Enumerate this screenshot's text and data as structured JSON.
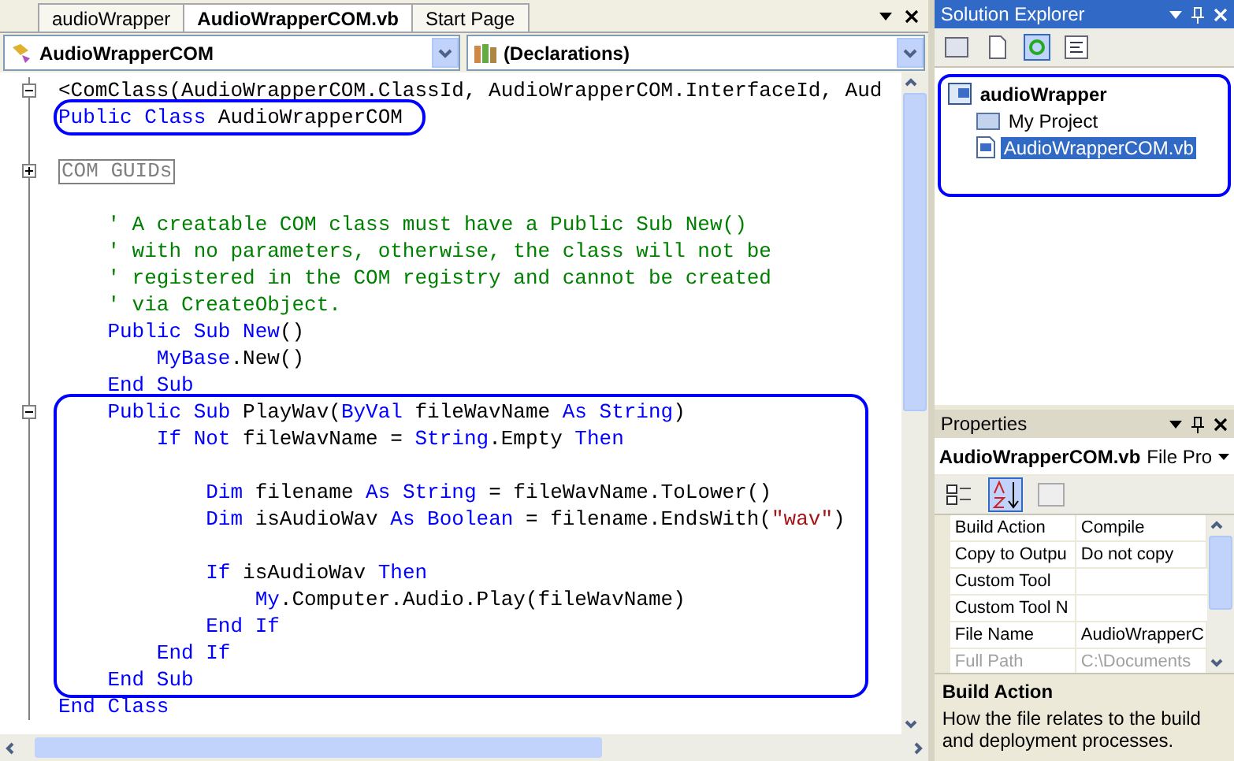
{
  "editor": {
    "tabs": [
      {
        "label": "audioWrapper",
        "selected": false
      },
      {
        "label": "AudioWrapperCOM.vb",
        "selected": true
      },
      {
        "label": "Start Page",
        "selected": false
      }
    ],
    "class_dropdown": "AudioWrapperCOM",
    "member_dropdown": "(Declarations)",
    "code_groups": [
      {
        "circled": false,
        "lines": [
          {
            "kind": "code",
            "collapsed": false,
            "tokens": [
              {
                "kind": "plain",
                "text": "<ComClass(AudioWrapperCOM.ClassId, AudioWrapperCOM.InterfaceId, Aud"
              }
            ]
          }
        ]
      },
      {
        "circled": true,
        "lines": [
          {
            "kind": "code",
            "tokens": [
              {
                "kind": "kw",
                "text": "Public Class"
              },
              {
                "kind": "plain",
                "text": " AudioWrapperCOM"
              }
            ]
          }
        ]
      },
      {
        "circled": false,
        "lines": [
          {
            "kind": "blank"
          },
          {
            "kind": "region",
            "collapsed": true,
            "text": "COM GUIDs"
          },
          {
            "kind": "blank"
          },
          {
            "kind": "code",
            "tokens": [
              {
                "kind": "comment",
                "text": "    ' A creatable COM class must have a Public Sub New()"
              }
            ]
          },
          {
            "kind": "code",
            "tokens": [
              {
                "kind": "comment",
                "text": "    ' with no parameters, otherwise, the class will not be"
              }
            ]
          },
          {
            "kind": "code",
            "tokens": [
              {
                "kind": "comment",
                "text": "    ' registered in the COM registry and cannot be created"
              }
            ]
          },
          {
            "kind": "code",
            "tokens": [
              {
                "kind": "comment",
                "text": "    ' via CreateObject."
              }
            ]
          },
          {
            "kind": "code",
            "tokens": [
              {
                "kind": "kw",
                "text": "    Public Sub New"
              },
              {
                "kind": "plain",
                "text": "()"
              }
            ]
          },
          {
            "kind": "code",
            "tokens": [
              {
                "kind": "kw",
                "text": "        MyBase"
              },
              {
                "kind": "plain",
                "text": ".New()"
              }
            ]
          },
          {
            "kind": "code",
            "tokens": [
              {
                "kind": "kw",
                "text": "    End Sub"
              }
            ]
          }
        ]
      },
      {
        "circled": true,
        "lines": [
          {
            "kind": "code",
            "collapsed": false,
            "tokens": [
              {
                "kind": "kw",
                "text": "    Public Sub"
              },
              {
                "kind": "plain",
                "text": " PlayWav("
              },
              {
                "kind": "kw",
                "text": "ByVal"
              },
              {
                "kind": "plain",
                "text": " fileWavName "
              },
              {
                "kind": "kw",
                "text": "As String"
              },
              {
                "kind": "plain",
                "text": ")"
              }
            ]
          },
          {
            "kind": "code",
            "tokens": [
              {
                "kind": "kw",
                "text": "        If Not"
              },
              {
                "kind": "plain",
                "text": " fileWavName = "
              },
              {
                "kind": "kw",
                "text": "String"
              },
              {
                "kind": "plain",
                "text": ".Empty "
              },
              {
                "kind": "kw",
                "text": "Then"
              }
            ]
          },
          {
            "kind": "blank"
          },
          {
            "kind": "code",
            "tokens": [
              {
                "kind": "kw",
                "text": "            Dim"
              },
              {
                "kind": "plain",
                "text": " filename "
              },
              {
                "kind": "kw",
                "text": "As String"
              },
              {
                "kind": "plain",
                "text": " = fileWavName.ToLower()"
              }
            ]
          },
          {
            "kind": "code",
            "tokens": [
              {
                "kind": "kw",
                "text": "            Dim"
              },
              {
                "kind": "plain",
                "text": " isAudioWav "
              },
              {
                "kind": "kw",
                "text": "As Boolean"
              },
              {
                "kind": "plain",
                "text": " = filename.EndsWith("
              },
              {
                "kind": "string",
                "text": "\"wav\""
              },
              {
                "kind": "plain",
                "text": ")"
              }
            ]
          },
          {
            "kind": "blank"
          },
          {
            "kind": "code",
            "tokens": [
              {
                "kind": "kw",
                "text": "            If"
              },
              {
                "kind": "plain",
                "text": " isAudioWav "
              },
              {
                "kind": "kw",
                "text": "Then"
              }
            ]
          },
          {
            "kind": "code",
            "tokens": [
              {
                "kind": "kw",
                "text": "                My"
              },
              {
                "kind": "plain",
                "text": ".Computer.Audio.Play(fileWavName)"
              }
            ]
          },
          {
            "kind": "code",
            "tokens": [
              {
                "kind": "kw",
                "text": "            End If"
              }
            ]
          },
          {
            "kind": "code",
            "tokens": [
              {
                "kind": "kw",
                "text": "        End If"
              }
            ]
          },
          {
            "kind": "code",
            "tokens": [
              {
                "kind": "kw",
                "text": "    End Sub"
              }
            ]
          }
        ]
      },
      {
        "circled": false,
        "lines": [
          {
            "kind": "code",
            "tokens": [
              {
                "kind": "kw",
                "text": "End Class"
              }
            ]
          }
        ]
      }
    ]
  },
  "solution_explorer": {
    "title": "Solution Explorer",
    "circled": true,
    "tree": [
      {
        "label": "audioWrapper",
        "kind": "project",
        "selected": false,
        "children": [
          {
            "label": "My Project",
            "kind": "folder",
            "selected": false
          },
          {
            "label": "AudioWrapperCOM.vb",
            "kind": "file",
            "selected": true
          }
        ]
      }
    ]
  },
  "properties": {
    "title": "Properties",
    "object": "AudioWrapperCOM.vb",
    "object_type": "File Pro",
    "rows": [
      {
        "name": "Build Action",
        "value": "Compile",
        "disabled": false
      },
      {
        "name": "Copy to Outpu",
        "value": "Do not copy",
        "disabled": false
      },
      {
        "name": "Custom Tool",
        "disabled": false
      },
      {
        "name": "Custom Tool N",
        "disabled": false
      },
      {
        "name": "File Name",
        "value": "AudioWrapperC",
        "disabled": false
      },
      {
        "name": "Full Path",
        "value": "C:\\Documents",
        "disabled": true
      }
    ],
    "description_title": "Build Action",
    "description": "How the file relates to the build and deployment processes."
  }
}
